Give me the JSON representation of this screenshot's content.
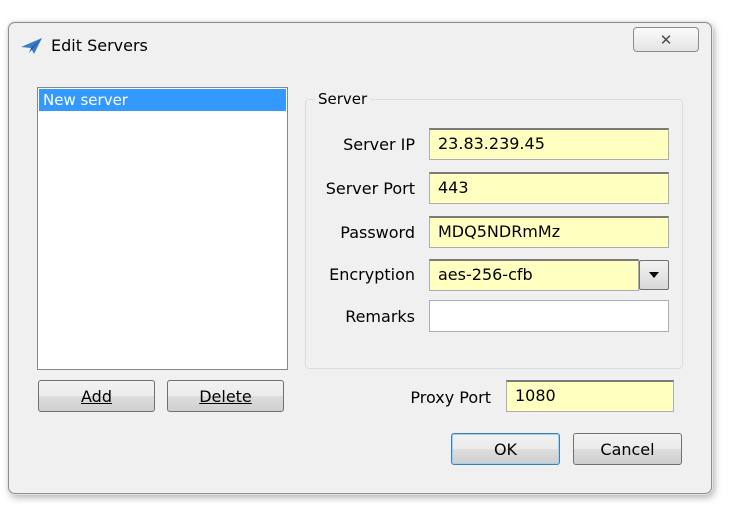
{
  "window": {
    "title": "Edit Servers",
    "close_glyph": "✕"
  },
  "server_list": {
    "items": [
      "New server"
    ],
    "selected_index": 0
  },
  "list_buttons": {
    "add_label": "Add",
    "delete_label": "Delete"
  },
  "server_group": {
    "label": "Server",
    "fields": {
      "server_ip": {
        "label": "Server IP",
        "value": "23.83.239.45"
      },
      "server_port": {
        "label": "Server Port",
        "value": "443"
      },
      "password": {
        "label": "Password",
        "value": "MDQ5NDRmMz"
      },
      "encryption": {
        "label": "Encryption",
        "value": "aes-256-cfb"
      },
      "remarks": {
        "label": "Remarks",
        "value": ""
      }
    }
  },
  "proxy_port": {
    "label": "Proxy Port",
    "value": "1080"
  },
  "dialog_buttons": {
    "ok_label": "OK",
    "cancel_label": "Cancel"
  },
  "colors": {
    "selection": "#3399ff",
    "input_highlight": "#ffffc0",
    "dialog_bg": "#f0f0f0"
  },
  "icons": {
    "app": "paper-plane-icon",
    "close": "close-icon",
    "dropdown": "chevron-down-icon"
  }
}
